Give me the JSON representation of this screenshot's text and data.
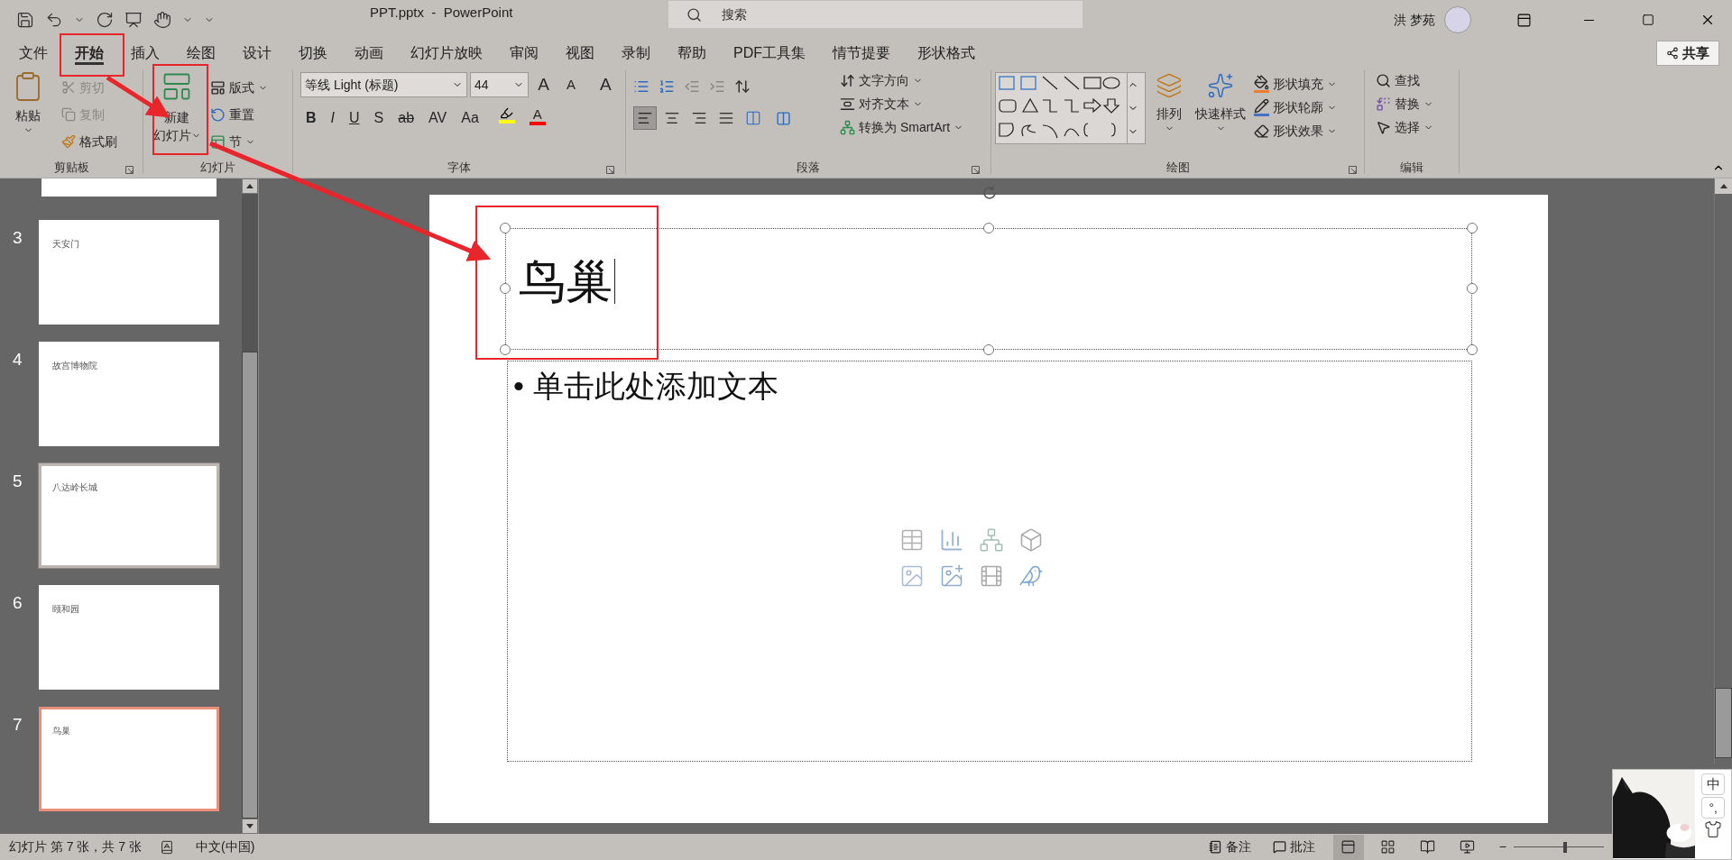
{
  "window": {
    "title": "PPT.pptx  -  PowerPoint",
    "search_placeholder": "搜索",
    "user": "洪 梦苑"
  },
  "ribbon_tabs": [
    {
      "label": "文件",
      "selected": false
    },
    {
      "label": "开始",
      "selected": true
    },
    {
      "label": "插入",
      "selected": false
    },
    {
      "label": "绘图",
      "selected": false
    },
    {
      "label": "设计",
      "selected": false
    },
    {
      "label": "切换",
      "selected": false
    },
    {
      "label": "动画",
      "selected": false
    },
    {
      "label": "幻灯片放映",
      "selected": false
    },
    {
      "label": "审阅",
      "selected": false
    },
    {
      "label": "视图",
      "selected": false
    },
    {
      "label": "录制",
      "selected": false
    },
    {
      "label": "帮助",
      "selected": false
    },
    {
      "label": "PDF工具集",
      "selected": false
    },
    {
      "label": "情节提要",
      "selected": false
    },
    {
      "label": "形状格式",
      "selected": false
    }
  ],
  "share": "共享",
  "clipboard": {
    "label": "剪贴板",
    "paste": "粘贴",
    "tools": [
      {
        "label": "剪切",
        "disabled": true
      },
      {
        "label": "复制",
        "disabled": true
      },
      {
        "label": "格式刷",
        "disabled": false
      }
    ]
  },
  "slides_group": {
    "label": "幻灯片",
    "new_slide": [
      "新建",
      "幻灯片"
    ],
    "tools": [
      "版式",
      "重置",
      "节"
    ]
  },
  "font": {
    "label": "字体",
    "family": "等线 Light (标题)",
    "size": "44",
    "size_buttons": [
      "A",
      "A",
      "A"
    ],
    "styles": [
      "B",
      "I",
      "U",
      "S",
      "ab",
      "AV",
      "Aa"
    ],
    "font_color_letter": "A"
  },
  "paragraph": {
    "label": "段落",
    "align": [
      {
        "kind": "left",
        "selected": true
      },
      {
        "kind": "center",
        "selected": false
      },
      {
        "kind": "right",
        "selected": false
      },
      {
        "kind": "justify",
        "selected": false
      },
      {
        "kind": "distributed",
        "selected": false
      }
    ],
    "tools": [
      "文字方向",
      "对齐文本",
      "转换为 SmartArt"
    ]
  },
  "drawing": {
    "label": "绘图",
    "arrange": "排列",
    "quick_styles": "快速样式",
    "tools": [
      {
        "label": "形状填充",
        "color": "#ed7d31"
      },
      {
        "label": "形状轮廓",
        "color": "#4472c4"
      },
      {
        "label": "形状效果"
      }
    ]
  },
  "editing": {
    "label": "编辑",
    "tools": [
      "查找",
      "替换",
      "选择"
    ]
  },
  "slides": [
    {
      "number": "3",
      "title": "天安门",
      "selected": false,
      "hovered": false
    },
    {
      "number": "4",
      "title": "故宫博物院",
      "selected": false,
      "hovered": false
    },
    {
      "number": "5",
      "title": "八达岭长城",
      "selected": false,
      "hovered": true
    },
    {
      "number": "6",
      "title": "颐和园",
      "selected": false,
      "hovered": false
    },
    {
      "number": "7",
      "title": "鸟巢",
      "selected": true,
      "hovered": false
    }
  ],
  "slide": {
    "title": "鸟巢",
    "bullet": "•",
    "body_placeholder": "单击此处添加文本"
  },
  "status_bar": {
    "position": "幻灯片 第 7 张，共 7 张",
    "language": "中文(中国)",
    "notes": "备注",
    "comments": "批注",
    "views": [
      {
        "kind": "normal",
        "selected": true
      },
      {
        "kind": "sorter",
        "selected": false
      },
      {
        "kind": "reading",
        "selected": false
      },
      {
        "kind": "slideshow",
        "selected": false
      }
    ],
    "zoom_minus": "−",
    "zoom": {
      "level": 0.55
    }
  },
  "ime": {
    "mode": "中",
    "punctuation": "°,"
  }
}
